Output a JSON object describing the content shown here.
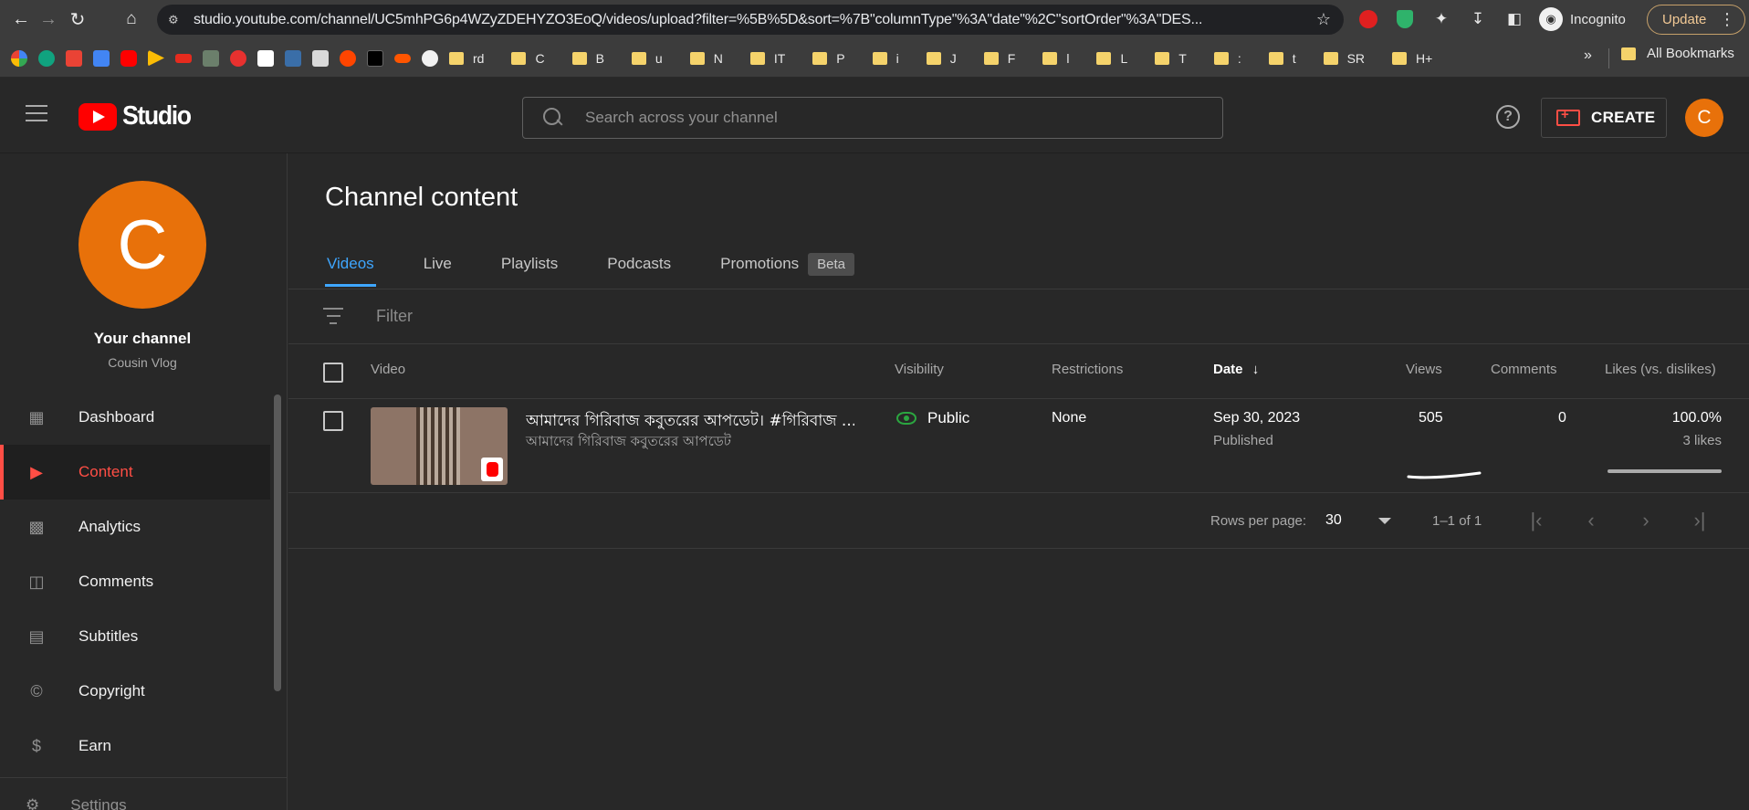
{
  "browser": {
    "url": "studio.youtube.com/channel/UC5mhPG6p4WZyZDEHYZO3EoQ/videos/upload?filter=%5B%5D&sort=%7B\"columnType\"%3A\"date\"%2C\"sortOrder\"%3A\"DES...",
    "incognito_label": "Incognito",
    "update_label": "Update",
    "bookmarks": [
      "rd",
      "C",
      "B",
      "u",
      "N",
      "IT",
      "P",
      "i",
      "J",
      "F",
      "l",
      "L",
      "T",
      ":",
      "t",
      "SR",
      "H+"
    ],
    "all_bookmarks_label": "All Bookmarks"
  },
  "header": {
    "logo_text": "Studio",
    "search_placeholder": "Search across your channel",
    "help_label": "?",
    "create_label": "CREATE",
    "avatar_letter": "C"
  },
  "sidebar": {
    "avatar_letter": "C",
    "channel_title": "Your channel",
    "channel_name": "Cousin Vlog",
    "items": [
      {
        "label": "Dashboard",
        "icon": "dashboard-icon"
      },
      {
        "label": "Content",
        "icon": "content-icon",
        "active": true
      },
      {
        "label": "Analytics",
        "icon": "analytics-icon"
      },
      {
        "label": "Comments",
        "icon": "comments-icon"
      },
      {
        "label": "Subtitles",
        "icon": "subtitles-icon"
      },
      {
        "label": "Copyright",
        "icon": "copyright-icon"
      },
      {
        "label": "Earn",
        "icon": "earn-icon"
      }
    ],
    "partial_item": "Settings"
  },
  "main": {
    "title": "Channel content",
    "tabs": [
      {
        "label": "Videos",
        "active": true
      },
      {
        "label": "Live"
      },
      {
        "label": "Playlists"
      },
      {
        "label": "Podcasts"
      },
      {
        "label": "Promotions"
      }
    ],
    "beta_badge": "Beta",
    "filter_placeholder": "Filter",
    "columns": {
      "video": "Video",
      "visibility": "Visibility",
      "restrictions": "Restrictions",
      "date": "Date",
      "views": "Views",
      "comments": "Comments",
      "likes": "Likes (vs. dislikes)"
    },
    "rows": [
      {
        "title": "আমাদের গিরিবাজ কবুতরের আপডেট। #গিরিবাজ ...",
        "description": "আমাদের গিরিবাজ কবুতরের আপডেট",
        "visibility": "Public",
        "restrictions": "None",
        "date": "Sep 30, 2023",
        "date_status": "Published",
        "views": "505",
        "comments": "0",
        "likes_pct": "100.0%",
        "likes_count": "3 likes"
      }
    ],
    "pager": {
      "rows_per_page_label": "Rows per page:",
      "rows_per_page": "30",
      "range": "1–1 of 1"
    }
  },
  "colors": {
    "accent_blue": "#3ea6ff",
    "active_red": "#ff4e45",
    "avatar_orange": "#e8710a",
    "public_green": "#2ba640"
  }
}
